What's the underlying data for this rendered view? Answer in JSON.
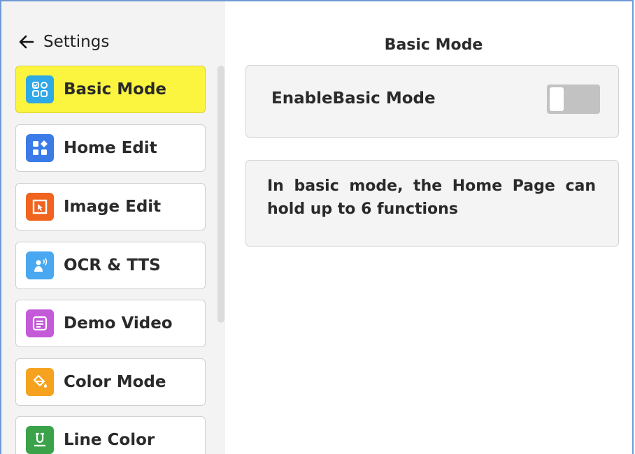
{
  "header": {
    "back_label": "Settings"
  },
  "sidebar": {
    "items": [
      {
        "label": "Basic Mode",
        "icon": "grid-check-icon",
        "color": "#2fa8e8",
        "active": true
      },
      {
        "label": "Home Edit",
        "icon": "home-grid-icon",
        "color": "#3b7be8",
        "active": false
      },
      {
        "label": "Image Edit",
        "icon": "image-frame-icon",
        "color": "#f0641f",
        "active": false
      },
      {
        "label": "OCR & TTS",
        "icon": "person-speak-icon",
        "color": "#49a8ef",
        "active": false
      },
      {
        "label": "Demo Video",
        "icon": "document-lines-icon",
        "color": "#c45ad8",
        "active": false
      },
      {
        "label": "Color Mode",
        "icon": "paint-bucket-icon",
        "color": "#f5a21e",
        "active": false
      },
      {
        "label": "Line Color",
        "icon": "underline-icon",
        "color": "#3aa34a",
        "active": false
      }
    ]
  },
  "main": {
    "title": "Basic Mode",
    "toggle_label": "EnableBasic Mode",
    "toggle_on": false,
    "info_text": "In basic mode, the Home Page can hold up to 6 functions"
  },
  "colors": {
    "active_item": "#fbf53f",
    "sidebar_bg": "#f3f3f3",
    "card_bg": "#f4f4f4"
  }
}
